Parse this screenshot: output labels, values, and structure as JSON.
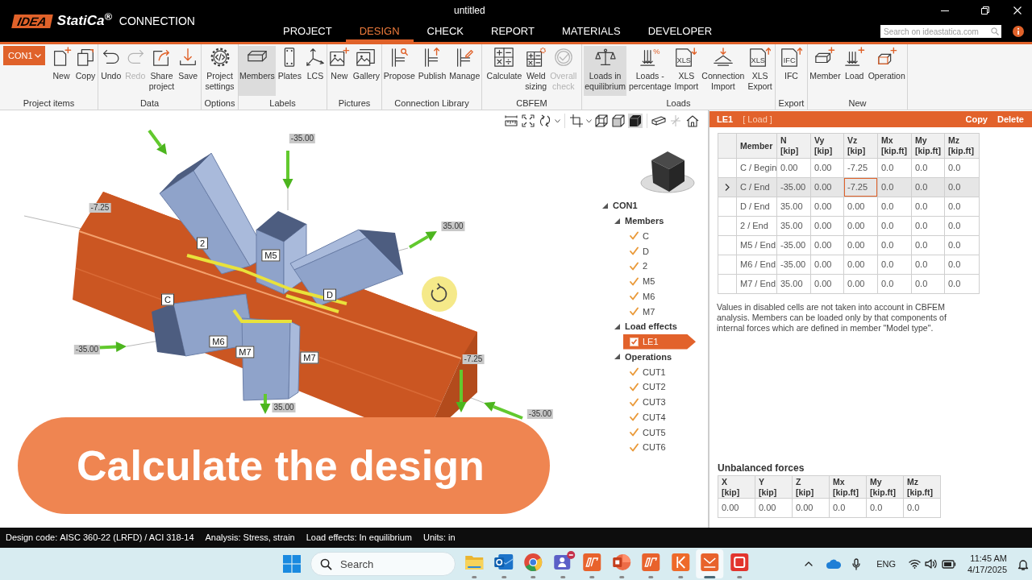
{
  "window": {
    "title": "untitled"
  },
  "app": {
    "logo_mark": "IDEA",
    "brand": "StatiCa$^{®}$",
    "product": "CONNECTION"
  },
  "menu": [
    {
      "label": "PROJECT",
      "selected": false
    },
    {
      "label": "DESIGN",
      "selected": true
    },
    {
      "label": "CHECK",
      "selected": false
    },
    {
      "label": "REPORT",
      "selected": false
    },
    {
      "label": "MATERIALS",
      "selected": false
    },
    {
      "label": "DEVELOPER",
      "selected": false
    }
  ],
  "web_search": {
    "placeholder": "Search on ideastatica.com"
  },
  "ribbon": {
    "connection": {
      "value": "CON1"
    },
    "groups": [
      {
        "label": "Project items",
        "items": [
          {
            "label": "New"
          },
          {
            "label": "Copy"
          }
        ]
      },
      {
        "label": "Data",
        "items": [
          {
            "label": "Undo",
            "disabled": false
          },
          {
            "label": "Redo",
            "disabled": true
          },
          {
            "label": "Share project",
            "disabled": false
          },
          {
            "label": "Save",
            "disabled": false
          }
        ]
      },
      {
        "label": "Options",
        "items": [
          {
            "label": "Project settings"
          }
        ]
      },
      {
        "label": "Labels",
        "items": [
          {
            "label": "Members",
            "selected": true
          },
          {
            "label": "Plates",
            "selected": false
          },
          {
            "label": "LCS",
            "selected": false
          }
        ]
      },
      {
        "label": "Pictures",
        "items": [
          {
            "label": "New"
          },
          {
            "label": "Gallery"
          }
        ]
      },
      {
        "label": "Connection Library",
        "items": [
          {
            "label": "Propose"
          },
          {
            "label": "Publish"
          },
          {
            "label": "Manage"
          }
        ]
      },
      {
        "label": "CBFEM",
        "items": [
          {
            "label": "Calculate",
            "disabled": false
          },
          {
            "label": "Weld sizing",
            "disabled": false
          },
          {
            "label": "Overall check",
            "disabled": true
          }
        ]
      },
      {
        "label": "Loads",
        "items": [
          {
            "label": "Loads in equilibrium",
            "selected": true
          },
          {
            "label": "Loads - percentage",
            "icon_text": "%",
            "selected": false
          },
          {
            "label": "XLS Import",
            "icon_text": "XLS",
            "selected": false
          },
          {
            "label": "Connection Import",
            "selected": false
          },
          {
            "label": "XLS Export",
            "icon_text": "XLS",
            "selected": false
          }
        ]
      },
      {
        "label": "Export",
        "items": [
          {
            "label": "IFC",
            "icon_text": "IFC"
          }
        ]
      },
      {
        "label": "New",
        "items": [
          {
            "label": "Member"
          },
          {
            "label": "Load"
          },
          {
            "label": "Operation"
          }
        ]
      }
    ]
  },
  "model_view": {
    "view_toolbar": [
      {
        "selected": false,
        "disabled": false
      },
      {
        "selected": false,
        "disabled": false
      },
      {
        "selected": false,
        "disabled": false
      },
      {
        "selected": false,
        "disabled": false
      },
      {
        "selected": false,
        "disabled": false
      },
      {
        "selected": false,
        "disabled": false
      },
      {
        "selected": true,
        "disabled": false
      },
      {
        "selected": false,
        "disabled": false
      },
      {
        "selected": false,
        "disabled": true
      },
      {
        "selected": false,
        "disabled": false
      }
    ],
    "member_labels": [
      "2",
      "M5",
      "D",
      "C",
      "M6",
      "M7",
      "M7"
    ],
    "force_labels": [
      "-35.00",
      "-7.25",
      "35.00",
      "-35.00",
      "-7.25",
      "-35.00",
      "35.00"
    ],
    "tree": {
      "label": "CON1",
      "expanded": true,
      "children": [
        {
          "label": "Members",
          "expanded": true,
          "children": [
            {
              "label": "C",
              "checked": true,
              "selected": false
            },
            {
              "label": "D",
              "checked": true,
              "selected": false
            },
            {
              "label": "2",
              "checked": true,
              "selected": false
            },
            {
              "label": "M5",
              "checked": true,
              "selected": false
            },
            {
              "label": "M6",
              "checked": true,
              "selected": false
            },
            {
              "label": "M7",
              "checked": true,
              "selected": false
            }
          ]
        },
        {
          "label": "Load effects",
          "expanded": true,
          "children": [
            {
              "label": "LE1",
              "checked": true,
              "selected": true
            }
          ]
        },
        {
          "label": "Operations",
          "expanded": true,
          "children": [
            {
              "label": "CUT1",
              "checked": true,
              "selected": false
            },
            {
              "label": "CUT2",
              "checked": true,
              "selected": false
            },
            {
              "label": "CUT3",
              "checked": true,
              "selected": false
            },
            {
              "label": "CUT4",
              "checked": true,
              "selected": false
            },
            {
              "label": "CUT5",
              "checked": true,
              "selected": false
            },
            {
              "label": "CUT6",
              "checked": true,
              "selected": false
            }
          ]
        }
      ]
    },
    "caption": "Calculate the design"
  },
  "load_panel": {
    "title": "LE1",
    "subtitle": "[ Load ]",
    "actions": [
      "Copy",
      "Delete"
    ],
    "table": {
      "columns": [
        {
          "label": "Member"
        },
        {
          "label": "N",
          "unit": "[kip]"
        },
        {
          "label": "Vy",
          "unit": "[kip]"
        },
        {
          "label": "Vz",
          "unit": "[kip]"
        },
        {
          "label": "Mx",
          "unit": "[kip.ft]"
        },
        {
          "label": "My",
          "unit": "[kip.ft]"
        },
        {
          "label": "Mz",
          "unit": "[kip.ft]"
        }
      ],
      "rows": [
        {
          "selected": false,
          "cells": [
            {
              "text": "C / Begin",
              "focused": false
            },
            {
              "text": "0.00",
              "focused": false
            },
            {
              "text": "0.00",
              "focused": false
            },
            {
              "text": "-7.25",
              "focused": false
            },
            {
              "text": "0.0",
              "focused": false
            },
            {
              "text": "0.0",
              "focused": false
            },
            {
              "text": "0.0",
              "focused": false
            }
          ]
        },
        {
          "selected": true,
          "cells": [
            {
              "text": "C / End",
              "focused": false
            },
            {
              "text": "-35.00",
              "focused": false
            },
            {
              "text": "0.00",
              "focused": false
            },
            {
              "text": "-7.25",
              "focused": true
            },
            {
              "text": "0.0",
              "focused": false
            },
            {
              "text": "0.0",
              "focused": false
            },
            {
              "text": "0.0",
              "focused": false
            }
          ]
        },
        {
          "selected": false,
          "cells": [
            {
              "text": "D / End",
              "focused": false
            },
            {
              "text": "35.00",
              "focused": false
            },
            {
              "text": "0.00",
              "focused": false
            },
            {
              "text": "0.00",
              "focused": false
            },
            {
              "text": "0.0",
              "focused": false
            },
            {
              "text": "0.0",
              "focused": false
            },
            {
              "text": "0.0",
              "focused": false
            }
          ]
        },
        {
          "selected": false,
          "cells": [
            {
              "text": "2 / End",
              "focused": false
            },
            {
              "text": "35.00",
              "focused": false
            },
            {
              "text": "0.00",
              "focused": false
            },
            {
              "text": "0.00",
              "focused": false
            },
            {
              "text": "0.0",
              "focused": false
            },
            {
              "text": "0.0",
              "focused": false
            },
            {
              "text": "0.0",
              "focused": false
            }
          ]
        },
        {
          "selected": false,
          "cells": [
            {
              "text": "M5 / End",
              "focused": false
            },
            {
              "text": "-35.00",
              "focused": false
            },
            {
              "text": "0.00",
              "focused": false
            },
            {
              "text": "0.00",
              "focused": false
            },
            {
              "text": "0.0",
              "focused": false
            },
            {
              "text": "0.0",
              "focused": false
            },
            {
              "text": "0.0",
              "focused": false
            }
          ]
        },
        {
          "selected": false,
          "cells": [
            {
              "text": "M6 / End",
              "focused": false
            },
            {
              "text": "-35.00",
              "focused": false
            },
            {
              "text": "0.00",
              "focused": false
            },
            {
              "text": "0.00",
              "focused": false
            },
            {
              "text": "0.0",
              "focused": false
            },
            {
              "text": "0.0",
              "focused": false
            },
            {
              "text": "0.0",
              "focused": false
            }
          ]
        },
        {
          "selected": false,
          "cells": [
            {
              "text": "M7 / End",
              "focused": false
            },
            {
              "text": "35.00",
              "focused": false
            },
            {
              "text": "0.00",
              "focused": false
            },
            {
              "text": "0.00",
              "focused": false
            },
            {
              "text": "0.0",
              "focused": false
            },
            {
              "text": "0.0",
              "focused": false
            },
            {
              "text": "0.0",
              "focused": false
            }
          ]
        }
      ]
    },
    "note": "Values in disabled cells are not taken into account in CBFEM analysis. Members can be loaded only by that components of internal forces which are defined in member \"Model type\".",
    "unbalanced": {
      "title": "Unbalanced forces",
      "columns": [
        {
          "label": "X",
          "unit": "[kip]"
        },
        {
          "label": "Y",
          "unit": "[kip]"
        },
        {
          "label": "Z",
          "unit": "[kip]"
        },
        {
          "label": "Mx",
          "unit": "[kip.ft]"
        },
        {
          "label": "My",
          "unit": "[kip.ft]"
        },
        {
          "label": "Mz",
          "unit": "[kip.ft]"
        }
      ],
      "rows": [
        [
          "0.00",
          "0.00",
          "0.00",
          "0.0",
          "0.0",
          "0.0"
        ]
      ]
    }
  },
  "status_bar": [
    {
      "label": "Design code:",
      "value": "AISC 360-22 (LRFD) / ACI 318-14"
    },
    {
      "label": "Analysis:",
      "value": "Stress, strain"
    },
    {
      "label": "Load effects:",
      "value": "In equilibrium"
    },
    {
      "label": "Units:",
      "value": "in"
    }
  ],
  "taskbar": {
    "search": {
      "placeholder": "Search"
    },
    "apps": [
      {
        "active": false,
        "badge": false
      },
      {
        "active": false,
        "badge": false
      },
      {
        "active": false,
        "badge": false
      },
      {
        "active": false,
        "badge": true
      },
      {
        "active": false,
        "badge": false
      },
      {
        "active": false,
        "badge": false
      },
      {
        "active": false,
        "badge": false
      },
      {
        "active": false,
        "badge": false
      },
      {
        "active": true,
        "badge": false
      },
      {
        "active": false,
        "badge": false
      }
    ],
    "language": "ENG",
    "time": "11:45 AM",
    "date": "4/17/2025"
  }
}
